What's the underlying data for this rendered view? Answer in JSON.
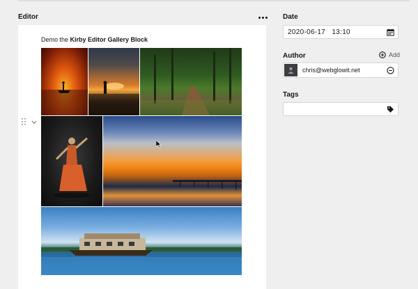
{
  "editor": {
    "label": "Editor",
    "text_prefix": "Demo the ",
    "text_bold": "Kirby Editor Gallery Block",
    "gallery": [
      {
        "id": "boat-sunset"
      },
      {
        "id": "sunset-silhouette"
      },
      {
        "id": "forest-path"
      },
      {
        "id": "dancer"
      },
      {
        "id": "sunset-pier"
      },
      {
        "id": "houseboat"
      }
    ],
    "icons": {
      "more": "more-dots-icon",
      "drag": "drag-handle-icon",
      "toggle": "chevron-down-icon"
    }
  },
  "sidebar": {
    "date": {
      "label": "Date",
      "value": "2020-06-17   13:10",
      "icon": "calendar-icon"
    },
    "author": {
      "label": "Author",
      "add_label": "Add",
      "email": "chris@webglowit.net",
      "icons": {
        "add": "plus-circle-icon",
        "remove": "minus-circle-icon",
        "avatar": "user-icon"
      }
    },
    "tags": {
      "label": "Tags",
      "value": "",
      "icon": "tag-icon"
    }
  },
  "colors": {
    "background": "#efefef",
    "panel": "#ffffff",
    "text": "#16171a"
  }
}
